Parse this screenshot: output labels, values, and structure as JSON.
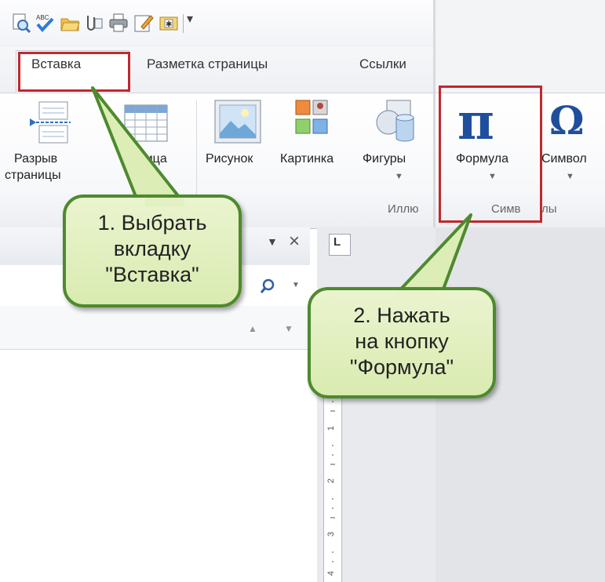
{
  "tabs": {
    "insert": "Вставка",
    "page_layout": "Разметка страницы",
    "references": "Ссылки"
  },
  "ribbon": {
    "page_break_line1": "Разрыв",
    "page_break_line2": "страницы",
    "table": "Таблица",
    "picture": "Рисунок",
    "clip_art": "Картинка",
    "shapes": "Фигуры",
    "equation": "Формула",
    "symbol": "Символ",
    "group_illustrations": "Иллю",
    "group_symbols": "Симв",
    "group_symbols_tail": "лы",
    "pi_glyph": "π",
    "omega_glyph": "Ω"
  },
  "nav": {
    "close_glyph": "×"
  },
  "ruler": {
    "marks": [
      "1",
      "2",
      "3",
      "4"
    ],
    "tab_glyph": "L"
  },
  "callouts": {
    "step1_line1": "1. Выбрать",
    "step1_line2": "вкладку",
    "step1_line3": "\"Вставка\"",
    "step2_line1": "2. Нажать",
    "step2_line2": "на кнопку",
    "step2_line3": "\"Формула\""
  },
  "colors": {
    "highlight": "#c0282d",
    "callout_border": "#4d8a2e",
    "callout_fill": "#dcedb6",
    "pi": "#1f4e9c"
  }
}
